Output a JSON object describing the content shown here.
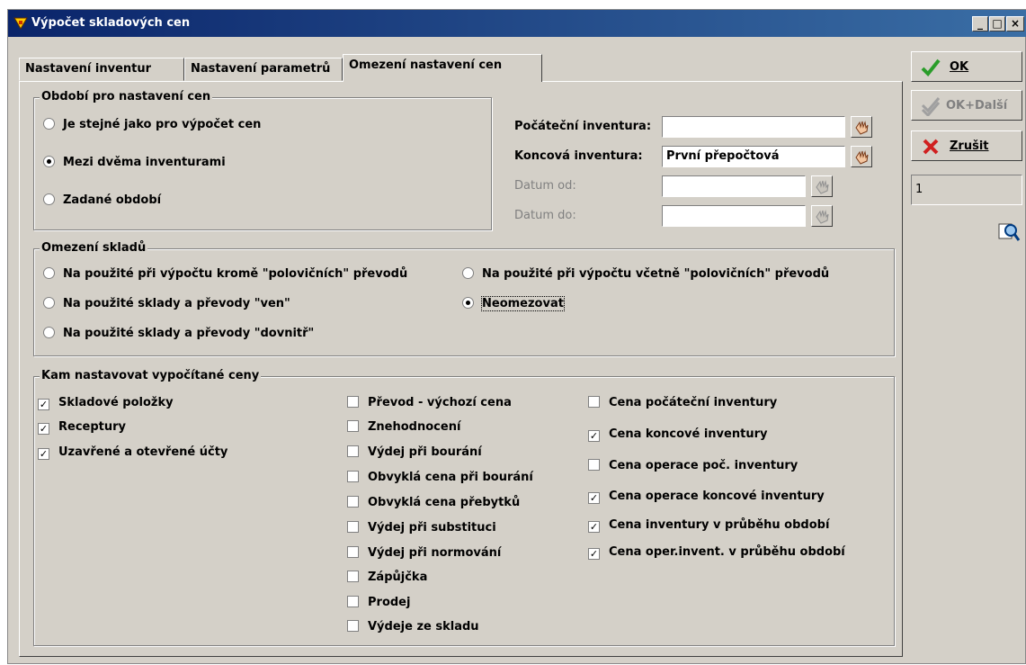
{
  "window": {
    "title": "Výpočet skladových cen",
    "controls": [
      "_",
      "□",
      "×"
    ]
  },
  "tabs": [
    {
      "label": "Nastavení inventur"
    },
    {
      "label": "Nastavení parametrů"
    },
    {
      "label": "Omezení nastavení cen",
      "active": true
    }
  ],
  "period": {
    "legend": "Období pro nastavení cen",
    "options": [
      {
        "label": "Je stejné jako pro výpočet cen",
        "selected": false
      },
      {
        "label": "Mezi dvěma inventurami",
        "selected": true
      },
      {
        "label": "Zadané období",
        "selected": false
      }
    ],
    "start_label": "Počáteční inventura:",
    "start_value": "",
    "end_label": "Koncová inventura:",
    "end_value": "První přepočtová",
    "date_from_label": "Datum od:",
    "date_from_value": "",
    "date_to_label": "Datum do:",
    "date_to_value": ""
  },
  "warehouses": {
    "legend": "Omezení skladů",
    "options": [
      {
        "label": "Na použité při výpočtu kromě \"polovičních\" převodů",
        "selected": false
      },
      {
        "label": "Na použité při výpočtu včetně \"polovičních\" převodů",
        "selected": false
      },
      {
        "label": "Na použité sklady a převody \"ven\"",
        "selected": false
      },
      {
        "label": "Neomezovat",
        "selected": true
      },
      {
        "label": "Na použité sklady a převody \"dovnitř\"",
        "selected": false
      }
    ]
  },
  "targets": {
    "legend": "Kam nastavovat vypočítané ceny",
    "col1": [
      {
        "label": "Skladové položky",
        "checked": true
      },
      {
        "label": "Receptury",
        "checked": true
      },
      {
        "label": "Uzavřené a otevřené účty",
        "checked": true
      }
    ],
    "col2": [
      {
        "label": "Převod - výchozí cena",
        "checked": false
      },
      {
        "label": "Znehodnocení",
        "checked": false
      },
      {
        "label": "Výdej při bourání",
        "checked": false
      },
      {
        "label": "Obvyklá cena při bourání",
        "checked": false
      },
      {
        "label": "Obvyklá cena přebytků",
        "checked": false
      },
      {
        "label": "Výdej při substituci",
        "checked": false
      },
      {
        "label": "Výdej při normování",
        "checked": false
      },
      {
        "label": "Zápůjčka",
        "checked": false
      },
      {
        "label": "Prodej",
        "checked": false
      },
      {
        "label": "Výdeje ze skladu",
        "checked": false
      }
    ],
    "col3": [
      {
        "label": "Cena počáteční inventury",
        "checked": false
      },
      {
        "label": "Cena koncové inventury",
        "checked": true
      },
      {
        "label": "Cena operace poč. inventury",
        "checked": false
      },
      {
        "label": "Cena operace koncové inventury",
        "checked": true
      },
      {
        "label": "Cena inventury v průběhu období",
        "checked": true
      },
      {
        "label": "Cena oper.invent. v průběhu období",
        "checked": true
      }
    ]
  },
  "side": {
    "ok_label": "OK",
    "ok_next_label": "OK+Další",
    "cancel_label": "Zrušit",
    "counter": "1"
  },
  "colors": {
    "title_start": "#0a246a",
    "title_end": "#3a6ea5",
    "face": "#d4d0c8",
    "ok_green": "#2a9d2a",
    "cancel_red": "#d02020"
  }
}
